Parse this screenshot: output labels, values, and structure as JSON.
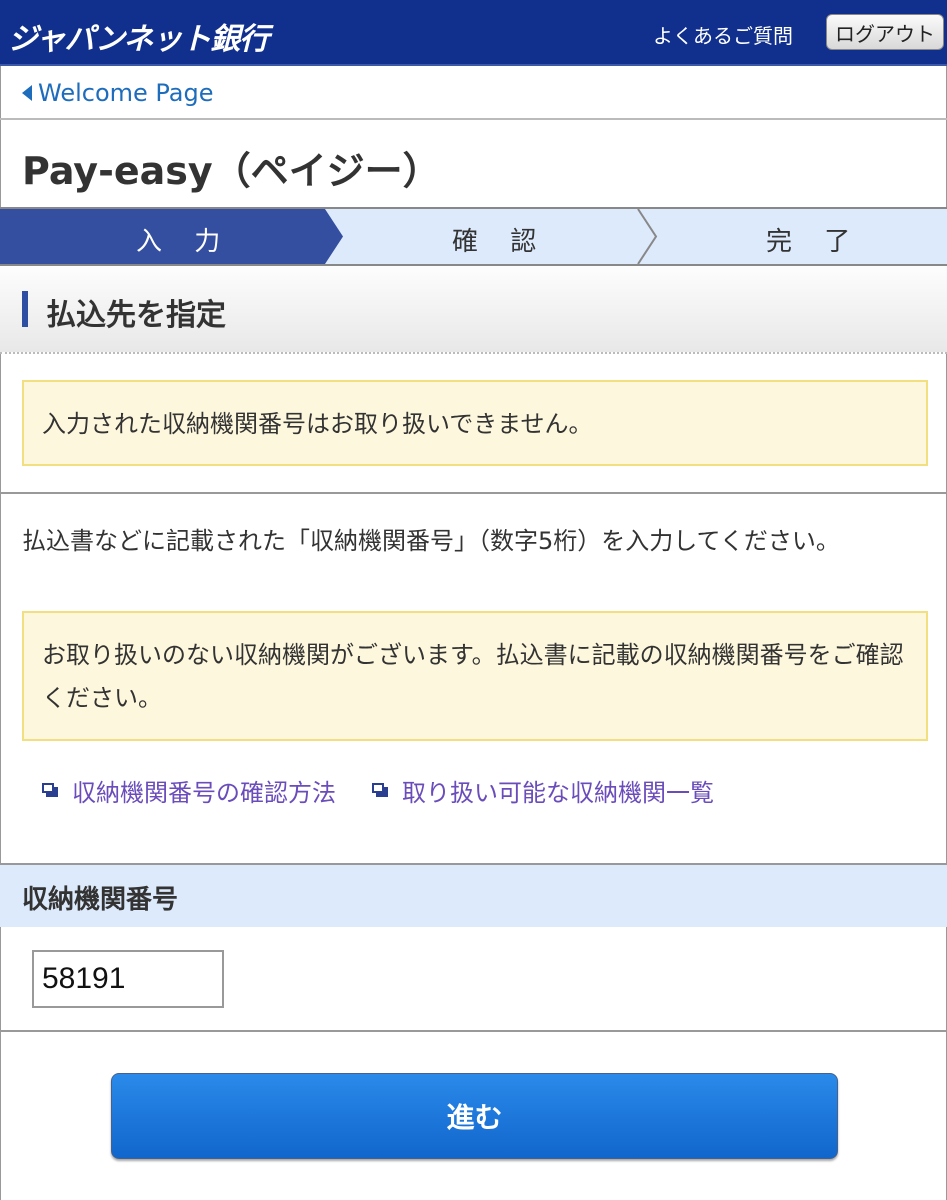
{
  "header": {
    "logo": "ジャパンネット銀行",
    "faq_link": "よくあるご質問",
    "logout_button": "ログアウト",
    "brand_color": "#11308e"
  },
  "breadcrumb": {
    "back_link": "Welcome Page"
  },
  "page_title": "Pay-easy（ペイジー）",
  "steps": [
    {
      "label": "入 力",
      "active": true
    },
    {
      "label": "確 認",
      "active": false
    },
    {
      "label": "完 了",
      "active": false
    }
  ],
  "section_title": "払込先を指定",
  "error_notice": "入力された収納機関番号はお取り扱いできません。",
  "description": "払込書などに記載された「収納機関番号」（数字5桁）を入力してください。",
  "info_notice": "お取り扱いのない収納機関がございます。払込書に記載の収納機関番号をご確認ください。",
  "links": [
    {
      "label": "収納機関番号の確認方法",
      "icon": "new-window-icon"
    },
    {
      "label": "取り扱い可能な収納機関一覧",
      "icon": "new-window-icon"
    }
  ],
  "form": {
    "field_label": "収納機関番号",
    "field_value": "58191"
  },
  "submit_button": "進む"
}
